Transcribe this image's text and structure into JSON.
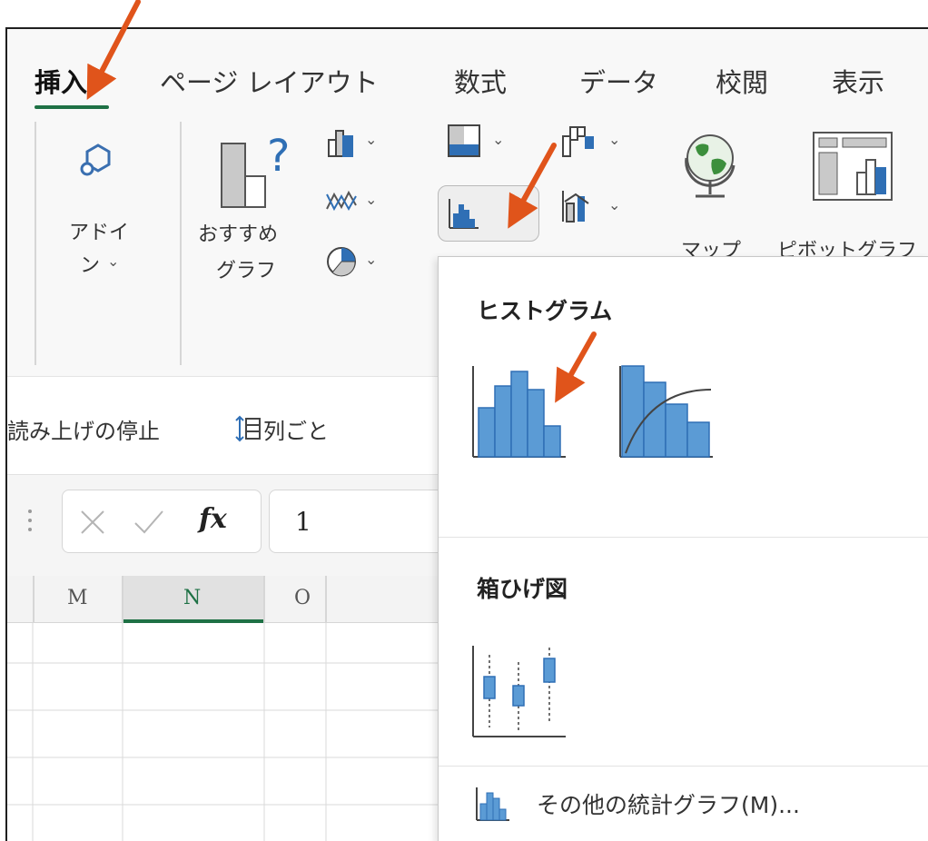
{
  "tabs": [
    "挿入",
    "ページ レイアウト",
    "数式",
    "データ",
    "校閲",
    "表示"
  ],
  "active_tab": "挿入",
  "ribbon": {
    "addins_label_line1": "アドイ",
    "addins_label_line2": "ン",
    "recommended_charts_line1": "おすすめ",
    "recommended_charts_line2": "グラフ",
    "map_label": "マップ",
    "pivot_chart_label": "ピボットグラフ"
  },
  "quick_access": {
    "read_stop": "読み上げの停止",
    "by_column": "列ごと"
  },
  "formula_bar": {
    "fx_symbol": "fx",
    "cell_value": "1"
  },
  "columns": [
    "M",
    "N",
    "O"
  ],
  "selected_column": "N",
  "dropdown": {
    "histogram_header": "ヒストグラム",
    "boxwhisker_header": "箱ひげ図",
    "more_stats_label": "その他の統計グラフ(M)..."
  },
  "colors": {
    "accent_green": "#1e7145",
    "chart_blue": "#5b9bd5",
    "chart_blue_light": "#9dc3e6",
    "arrow_orange": "#e0541b"
  },
  "icons": [
    "addins-icon",
    "recommended-charts-icon",
    "column-chart-icon",
    "line-chart-icon",
    "pie-chart-icon",
    "hierarchy-chart-icon",
    "statistic-chart-icon",
    "waterfall-chart-icon",
    "combo-chart-icon",
    "map-globe-icon",
    "pivot-chart-icon",
    "histogram-icon",
    "pareto-icon",
    "box-whisker-icon"
  ]
}
